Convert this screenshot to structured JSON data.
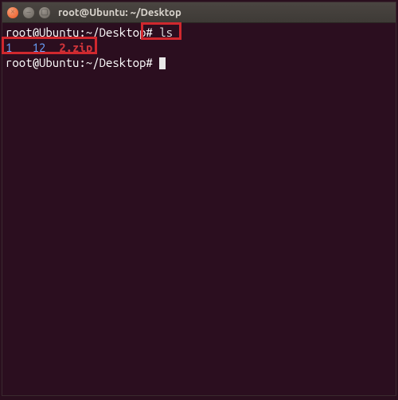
{
  "window": {
    "title": "root@Ubuntu: ~/Desktop",
    "controls": {
      "close": "×",
      "min": "–",
      "max": "▢"
    }
  },
  "terminal": {
    "lines": [
      {
        "prompt": "root@Ubuntu:~/Desktop#",
        "command": " ls"
      },
      {
        "output_items": [
          {
            "text": "1",
            "cls": "files-blue"
          },
          {
            "text": "   ",
            "cls": ""
          },
          {
            "text": "12",
            "cls": "files-blue"
          },
          {
            "text": "  ",
            "cls": ""
          },
          {
            "text": "2.zip",
            "cls": "files-red"
          }
        ]
      },
      {
        "prompt": "root@Ubuntu:~/Desktop#",
        "command": " "
      }
    ]
  }
}
